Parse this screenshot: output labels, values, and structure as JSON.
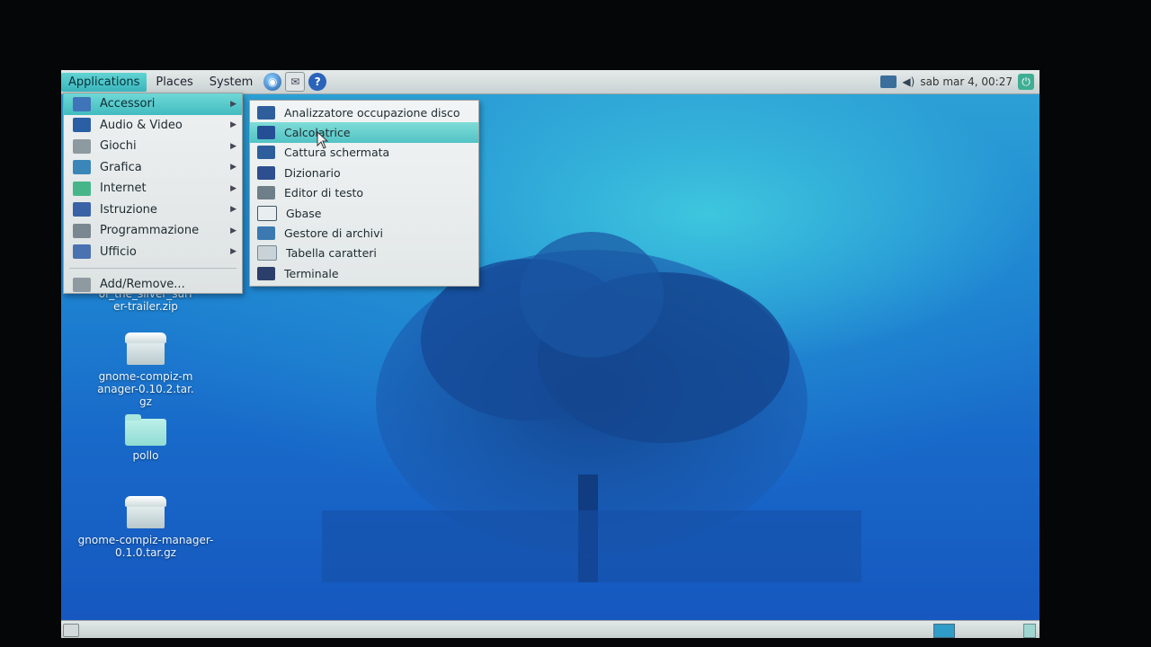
{
  "top_panel": {
    "menus": [
      "Applications",
      "Places",
      "System"
    ],
    "clock": "sab mar  4, 00:27"
  },
  "applications_menu": {
    "items": [
      {
        "label": "Accessori",
        "icon": "accessories-icon",
        "color": "#3f74b8"
      },
      {
        "label": "Audio & Video",
        "icon": "multimedia-icon",
        "color": "#2a5fa6"
      },
      {
        "label": "Giochi",
        "icon": "games-icon",
        "color": "#8d9aa0"
      },
      {
        "label": "Grafica",
        "icon": "graphics-icon",
        "color": "#3b86b8"
      },
      {
        "label": "Internet",
        "icon": "internet-icon",
        "color": "#46b68a"
      },
      {
        "label": "Istruzione",
        "icon": "education-icon",
        "color": "#3a62a6"
      },
      {
        "label": "Programmazione",
        "icon": "programming-icon",
        "color": "#7a8790"
      },
      {
        "label": "Ufficio",
        "icon": "office-icon",
        "color": "#4a72b0"
      }
    ],
    "add_remove": "Add/Remove..."
  },
  "accessori_submenu": {
    "items": [
      {
        "label": "Analizzatore occupazione disco",
        "icon": "disk-usage-icon",
        "color": "#2e5f9c"
      },
      {
        "label": "Calcolatrice",
        "icon": "calculator-icon",
        "color": "#244f95"
      },
      {
        "label": "Cattura schermata",
        "icon": "screenshot-icon",
        "color": "#2e5f9c"
      },
      {
        "label": "Dizionario",
        "icon": "dictionary-icon",
        "color": "#2d4f8f"
      },
      {
        "label": "Editor di testo",
        "icon": "text-editor-icon",
        "color": "#6f7f8a"
      },
      {
        "label": "Gbase",
        "icon": "gbase-icon",
        "color": "#e8eef0"
      },
      {
        "label": "Gestore di archivi",
        "icon": "archive-manager-icon",
        "color": "#3b79b0"
      },
      {
        "label": "Tabella caratteri",
        "icon": "character-map-icon",
        "color": "#c9d2d6"
      },
      {
        "label": "Terminale",
        "icon": "terminal-icon",
        "color": "#2c3f6a"
      }
    ]
  },
  "desktop": {
    "icons": [
      {
        "label": "of_the_silver_surfer-trailer.zip"
      },
      {
        "label": "gnome-compiz-manager-0.10.2.tar.gz"
      },
      {
        "label": "pollo"
      },
      {
        "label": "gnome-compiz-manager-0.1.0.tar.gz"
      }
    ]
  }
}
